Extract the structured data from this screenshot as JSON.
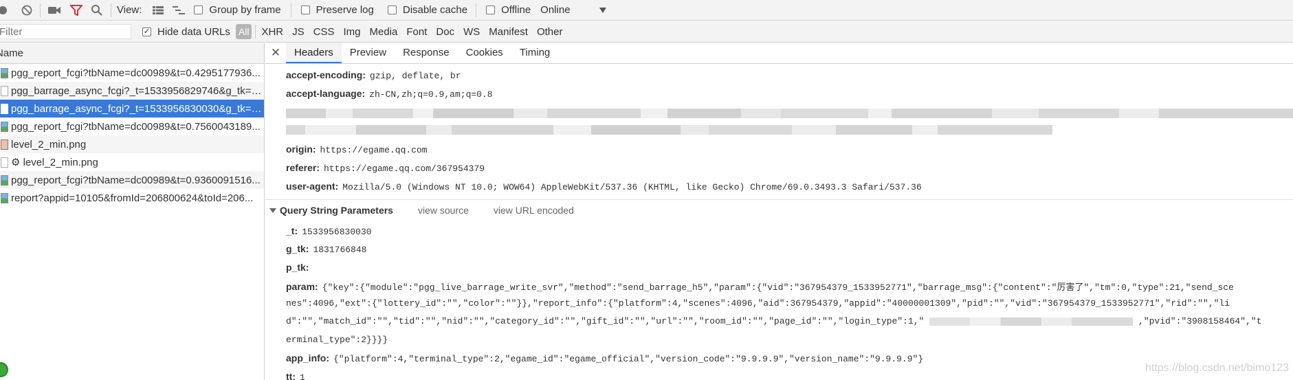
{
  "toolbar": {
    "view_label": "View:",
    "group_by_frame": "Group by frame",
    "preserve_log": "Preserve log",
    "disable_cache": "Disable cache",
    "offline": "Offline",
    "throttle": "Online"
  },
  "filterbar": {
    "filter_placeholder": "Filter",
    "hide_data_urls": "Hide data URLs",
    "types": [
      "All",
      "XHR",
      "JS",
      "CSS",
      "Img",
      "Media",
      "Font",
      "Doc",
      "WS",
      "Manifest",
      "Other"
    ]
  },
  "requests": {
    "column_name": "Name",
    "items": [
      {
        "name": "pgg_report_fcgi?tbName=dc00989&t=0.4295177936..."
      },
      {
        "name": "pgg_barrage_async_fcgi?_t=1533956829746&g_tk=1..."
      },
      {
        "name": "pgg_barrage_async_fcgi?_t=1533956830030&g_tk=1..."
      },
      {
        "name": "pgg_report_fcgi?tbName=dc00989&t=0.7560043189..."
      },
      {
        "name": "level_2_min.png"
      },
      {
        "name": "⚙ level_2_min.png"
      },
      {
        "name": "pgg_report_fcgi?tbName=dc00989&t=0.9360091516..."
      },
      {
        "name": "report?appid=10105&fromId=206800624&toId=206..."
      }
    ]
  },
  "details": {
    "tabs": [
      "Headers",
      "Preview",
      "Response",
      "Cookies",
      "Timing"
    ],
    "headers": [
      {
        "key": "accept-encoding:",
        "value": "gzip, deflate, br"
      },
      {
        "key": "accept-language:",
        "value": "zh-CN,zh;q=0.9,am;q=0.8"
      },
      {
        "key": "origin:",
        "value": "https://egame.qq.com"
      },
      {
        "key": "referer:",
        "value": "https://egame.qq.com/367954379"
      },
      {
        "key": "user-agent:",
        "value": "Mozilla/5.0 (Windows NT 10.0; WOW64) AppleWebKit/537.36 (KHTML, like Gecko) Chrome/69.0.3493.3 Safari/537.36"
      }
    ],
    "query_section": {
      "title": "Query String Parameters",
      "view_source": "view source",
      "view_url_encoded": "view URL encoded"
    },
    "params": [
      {
        "key": "_t:",
        "value": "1533956830030"
      },
      {
        "key": "g_tk:",
        "value": "1831766848"
      },
      {
        "key": "p_tk:",
        "value": ""
      },
      {
        "key": "param:",
        "value": "{\"key\":{\"module\":\"pgg_live_barrage_write_svr\",\"method\":\"send_barrage_h5\",\"param\":{\"vid\":\"367954379_1533952771\",\"barrage_msg\":{\"content\":\"厉害了\",\"tm\":0,\"type\":21,\"send_sce"
      },
      {
        "key": "app_info:",
        "value": "{\"platform\":4,\"terminal_type\":2,\"egame_id\":\"egame_official\",\"version_code\":\"9.9.9.9\",\"version_name\":\"9.9.9.9\"}"
      },
      {
        "key": "tt:",
        "value": "1"
      }
    ],
    "param_continuation": [
      "nes\":4096,\"ext\":{\"lottery_id\":\"\",\"color\":\"\"}},\"report_info\":{\"platform\":4,\"scenes\":4096,\"aid\":367954379,\"appid\":\"40000001309\",\"pid\":\"\",\"vid\":\"367954379_1533952771\",\"rid\":\"\",\"li",
      "d\":\"\",\"match_id\":\"\",\"tid\":\"\",\"nid\":\"\",\"category_id\":\"\",\"gift_id\":\"\",\"url\":\"\",\"room_id\":\"\",\"page_id\":\"\",\"login_type\":1,\"",
      "erminal_type\":2}}}}"
    ],
    "param_line3_tail": ",\"pvid\":\"3908158464\",\"t"
  },
  "watermark": "https://blog.csdn.net/bimo123"
}
